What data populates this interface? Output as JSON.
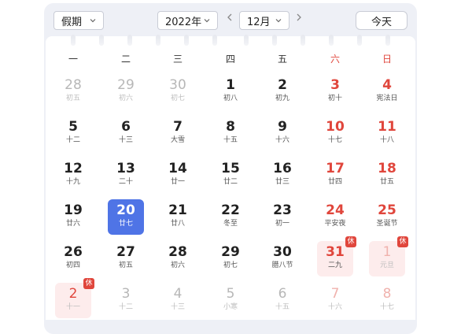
{
  "toolbar": {
    "holiday_select": "假期",
    "year_select": "2022年",
    "month_select": "12月",
    "today_label": "今天"
  },
  "weekdays": [
    "一",
    "二",
    "三",
    "四",
    "五",
    "六",
    "日"
  ],
  "calendar": {
    "year": 2022,
    "month": 12,
    "selected_day": "20",
    "rows": [
      [
        {
          "day": "28",
          "lunar": "初五",
          "other": true
        },
        {
          "day": "29",
          "lunar": "初六",
          "other": true
        },
        {
          "day": "30",
          "lunar": "初七",
          "other": true
        },
        {
          "day": "1",
          "lunar": "初八"
        },
        {
          "day": "2",
          "lunar": "初九"
        },
        {
          "day": "3",
          "lunar": "初十"
        },
        {
          "day": "4",
          "lunar": "宪法日"
        }
      ],
      [
        {
          "day": "5",
          "lunar": "十二"
        },
        {
          "day": "6",
          "lunar": "十三"
        },
        {
          "day": "7",
          "lunar": "大雪"
        },
        {
          "day": "8",
          "lunar": "十五"
        },
        {
          "day": "9",
          "lunar": "十六"
        },
        {
          "day": "10",
          "lunar": "十七"
        },
        {
          "day": "11",
          "lunar": "十八"
        }
      ],
      [
        {
          "day": "12",
          "lunar": "十九"
        },
        {
          "day": "13",
          "lunar": "二十"
        },
        {
          "day": "14",
          "lunar": "廿一"
        },
        {
          "day": "15",
          "lunar": "廿二"
        },
        {
          "day": "16",
          "lunar": "廿三"
        },
        {
          "day": "17",
          "lunar": "廿四"
        },
        {
          "day": "18",
          "lunar": "廿五"
        }
      ],
      [
        {
          "day": "19",
          "lunar": "廿六"
        },
        {
          "day": "20",
          "lunar": "廿七",
          "today": true
        },
        {
          "day": "21",
          "lunar": "廿八"
        },
        {
          "day": "22",
          "lunar": "冬至"
        },
        {
          "day": "23",
          "lunar": "初一"
        },
        {
          "day": "24",
          "lunar": "平安夜"
        },
        {
          "day": "25",
          "lunar": "圣诞节"
        }
      ],
      [
        {
          "day": "26",
          "lunar": "初四"
        },
        {
          "day": "27",
          "lunar": "初五"
        },
        {
          "day": "28",
          "lunar": "初六"
        },
        {
          "day": "29",
          "lunar": "初七"
        },
        {
          "day": "30",
          "lunar": "腊八节"
        },
        {
          "day": "31",
          "lunar": "二九",
          "holiday": true,
          "badge": "休"
        },
        {
          "day": "1",
          "lunar": "元旦",
          "holiday": true,
          "badge": "休",
          "other": true
        }
      ],
      [
        {
          "day": "2",
          "lunar": "十一",
          "holiday": true,
          "badge": "休",
          "other": true
        },
        {
          "day": "3",
          "lunar": "十二",
          "other": true
        },
        {
          "day": "4",
          "lunar": "十三",
          "other": true
        },
        {
          "day": "5",
          "lunar": "小寒",
          "other": true
        },
        {
          "day": "6",
          "lunar": "十五",
          "other": true
        },
        {
          "day": "7",
          "lunar": "十六",
          "other": true
        },
        {
          "day": "8",
          "lunar": "十七",
          "other": true
        }
      ]
    ]
  },
  "colors": {
    "accent": "#4f74e6",
    "weekend": "#e0463c",
    "holiday_bg": "#fdecec"
  }
}
